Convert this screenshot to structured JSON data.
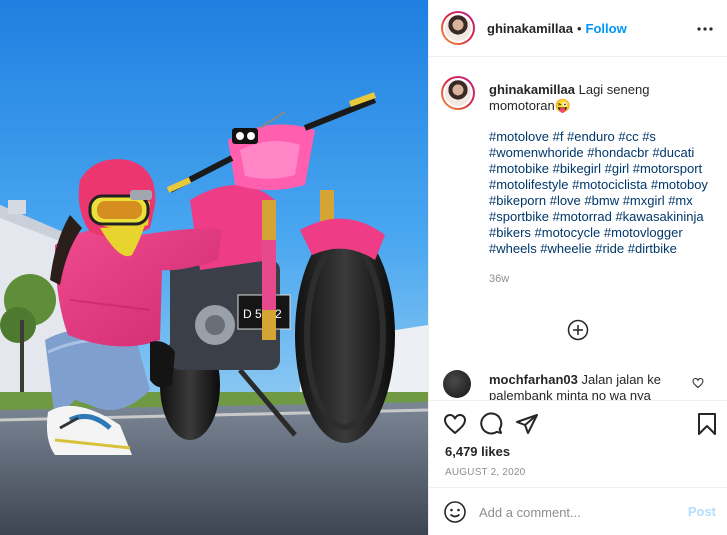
{
  "post": {
    "username": "ghinakamillaa",
    "separator": "•",
    "follow_label": "Follow",
    "more_icon": "more-horizontal-icon"
  },
  "caption": {
    "username": "ghinakamillaa",
    "text": "Lagi seneng momotoran😜",
    "hashtags": "#motolove #f #enduro #cc #s #womenwhoride #hondacbr #ducati #motobike #bikegirl #girl #motorsport #motolifestyle #motociclista #motoboy #bikeporn #love #bmw #mxgirl #mx #sportbike #motorrad #kawasakininja #bikers #motocycle #motovlogger #wheels #wheelie #ride #dirtbike",
    "time_ago": "36w"
  },
  "comments": [
    {
      "username": "mochfarhan03",
      "text": "Jalan jalan ke palembank minta no wa nya"
    }
  ],
  "actions": {
    "icons": [
      "heart-icon",
      "comment-icon",
      "share-icon",
      "save-icon"
    ],
    "likes": "6,479 likes",
    "date": "AUGUST 2, 2020"
  },
  "add_comment": {
    "placeholder": "Add a comment...",
    "post_label": "Post"
  },
  "colors": {
    "link_blue": "#0095f6",
    "hashtag_blue": "#00376b",
    "muted_gray": "#8e8e8e",
    "post_disabled": "#b2dffc",
    "sky": "#2f8fe8",
    "jacket_pink": "#e8337d"
  }
}
